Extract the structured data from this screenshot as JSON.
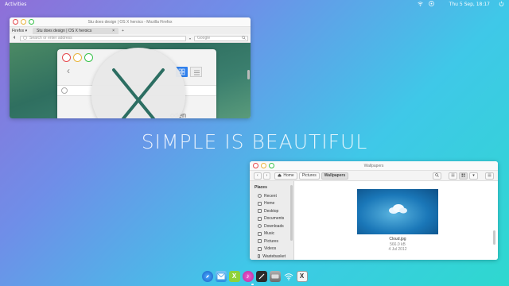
{
  "topbar": {
    "activities": "Activities",
    "clock": "Thu 5 Sep, 18:17"
  },
  "firefox": {
    "title": "Stu does design | OS X heroics - Mozilla Firefox",
    "menu": "Firefox ▾",
    "tab_label": "Stu does design | OS X heroics",
    "tab_close": "×",
    "new_tab": "+",
    "url_placeholder": "Search or enter address",
    "search_placeholder": "Google",
    "inner_word": "oden"
  },
  "tagline": "SIMPLE IS BEAUTIFUL",
  "nautilus": {
    "title": "Wallpapers",
    "crumbs": [
      "Home",
      "Pictures",
      "Wallpapers"
    ],
    "sidebar_header": "Places",
    "places": [
      "Recent",
      "Home",
      "Desktop",
      "Documents",
      "Downloads",
      "Music",
      "Pictures",
      "Videos",
      "Wastebasket"
    ],
    "file": {
      "name": "Cloud.jpg",
      "size": "566.0 kB",
      "date": "4 Jul 2012"
    }
  },
  "dock": {
    "items": [
      "safari-icon",
      "mail-icon",
      "x-app-icon",
      "itunes-icon",
      "edit-icon",
      "disk-icon",
      "wifi-icon",
      "x-logo-icon"
    ],
    "colors": [
      "#1e7bd8",
      "#4aa3e8",
      "#8fd23a",
      "#e84fbf",
      "#333333",
      "#888888",
      "#dddddd",
      "#f5f5f5"
    ]
  }
}
